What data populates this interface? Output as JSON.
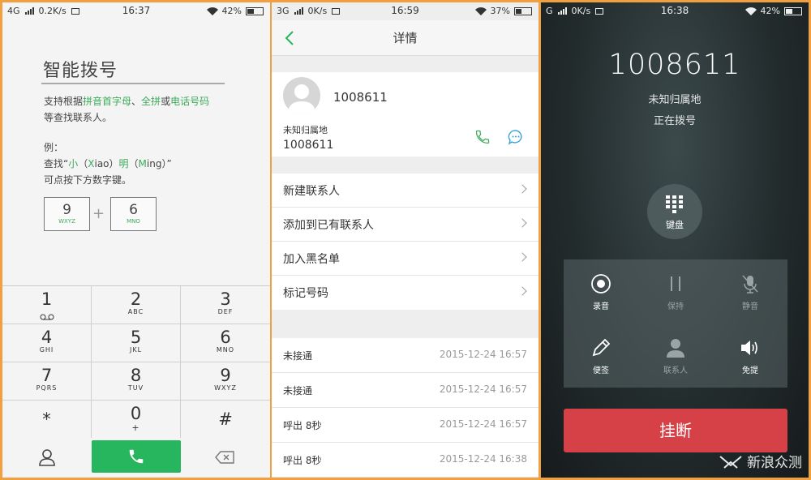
{
  "panel1": {
    "status": {
      "network": "4G",
      "speed": "0.2K/s",
      "time": "16:37",
      "battery": "42%"
    },
    "title": "智能拨号",
    "help": {
      "l1_a": "支持根据",
      "l1_b": "拼音首字母",
      "l1_c": "、",
      "l1_d": "全拼",
      "l1_e": "或",
      "l1_f": "电话号码",
      "l2": "等查找联系人。",
      "l3": "例：",
      "l4_a": "查找“",
      "l4_b": "小",
      "l4_c": "（",
      "l4_d": "X",
      "l4_e": "iao）",
      "l4_f": "明",
      "l4_g": "（",
      "l4_h": "M",
      "l4_i": "ing）”",
      "l5": "可点按下方数字键。"
    },
    "example_keys": [
      {
        "digit": "9",
        "letters": "WXYZ"
      },
      {
        "digit": "6",
        "letters": "MNO"
      }
    ],
    "plus": "+",
    "keys": [
      {
        "d": "1",
        "s": ""
      },
      {
        "d": "2",
        "s": "ABC"
      },
      {
        "d": "3",
        "s": "DEF"
      },
      {
        "d": "4",
        "s": "GHI"
      },
      {
        "d": "5",
        "s": "JKL"
      },
      {
        "d": "6",
        "s": "MNO"
      },
      {
        "d": "7",
        "s": "PQRS"
      },
      {
        "d": "8",
        "s": "TUV"
      },
      {
        "d": "9",
        "s": "WXYZ"
      },
      {
        "d": "*",
        "s": ""
      },
      {
        "d": "0",
        "s": "+"
      },
      {
        "d": "#",
        "s": ""
      }
    ]
  },
  "panel2": {
    "status": {
      "network": "3G",
      "speed": "0K/s",
      "time": "16:59",
      "battery": "37%"
    },
    "title": "详情",
    "number": "1008611",
    "location": "未知归属地",
    "number2": "1008611",
    "menu": [
      "新建联系人",
      "添加到已有联系人",
      "加入黑名单",
      "标记号码"
    ],
    "calls": [
      {
        "type": "未接通",
        "time": "2015-12-24  16:57"
      },
      {
        "type": "未接通",
        "time": "2015-12-24  16:57"
      },
      {
        "type": "呼出  8秒",
        "time": "2015-12-24  16:57"
      },
      {
        "type": "呼出  8秒",
        "time": "2015-12-24  16:38"
      }
    ]
  },
  "panel3": {
    "status": {
      "network": "G",
      "speed": "0K/s",
      "time": "16:38",
      "battery": "42%"
    },
    "number": "1008611",
    "location": "未知归属地",
    "state": "正在拨号",
    "keyboard": "键盘",
    "controls": [
      {
        "label": "录音",
        "icon": "record-icon"
      },
      {
        "label": "保持",
        "icon": "pause-icon"
      },
      {
        "label": "静音",
        "icon": "mute-icon"
      },
      {
        "label": "便签",
        "icon": "pencil-icon"
      },
      {
        "label": "联系人",
        "icon": "contact-icon"
      },
      {
        "label": "免提",
        "icon": "speaker-icon"
      }
    ],
    "hangup": "挂断",
    "watermark": "新浪众测"
  },
  "colors": {
    "accent_green": "#27b55d",
    "hangup_red": "#d64147"
  }
}
